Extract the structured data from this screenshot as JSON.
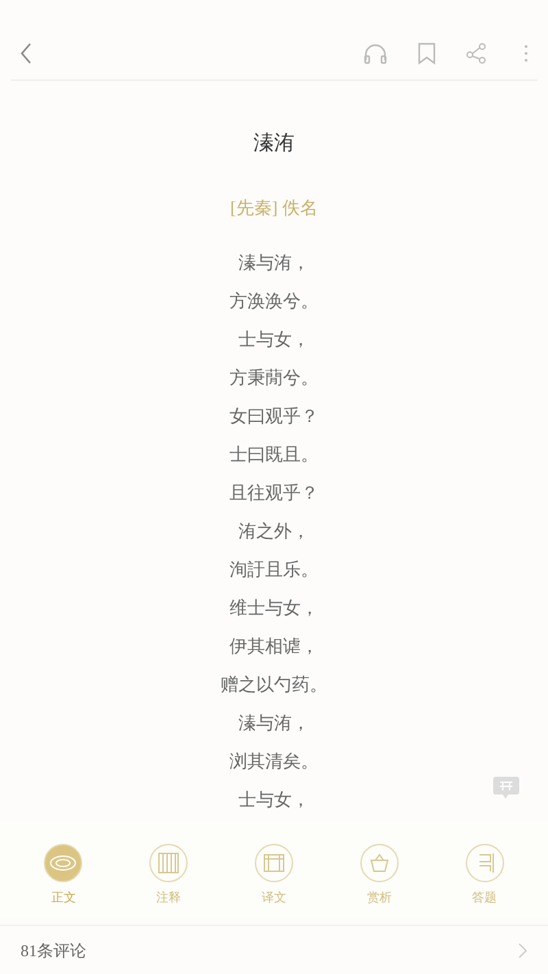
{
  "title": "溱洧",
  "author": "[先秦] 佚名",
  "lines": [
    "溱与洧，",
    "方涣涣兮。",
    "士与女，",
    "方秉蕑兮。",
    "女曰观乎？",
    "士曰既且。",
    "且往观乎？",
    "洧之外，",
    "洵訏且乐。",
    "维士与女，",
    "伊其相谑，",
    "赠之以勺药。",
    "溱与洧，",
    "浏其清矣。",
    "士与女，"
  ],
  "tabs": [
    {
      "label": "正文",
      "selected": true
    },
    {
      "label": "注释",
      "selected": false
    },
    {
      "label": "译文",
      "selected": false
    },
    {
      "label": "赏析",
      "selected": false
    },
    {
      "label": "答题",
      "selected": false
    }
  ],
  "comments": "81条评论"
}
